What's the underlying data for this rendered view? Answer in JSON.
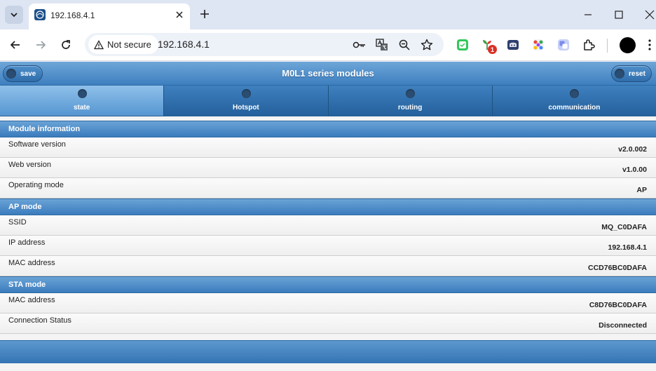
{
  "browser": {
    "tab_title": "192.168.4.1",
    "security_label": "Not secure",
    "url": "192.168.4.1",
    "extension_badge": "1"
  },
  "app": {
    "title": "M0L1 series modules",
    "save_label": "save",
    "reset_label": "reset",
    "nav": [
      "state",
      "Hotspot",
      "routing",
      "communication"
    ],
    "active_tab": "state"
  },
  "sections": [
    {
      "title": "Module information",
      "rows": [
        {
          "label": "Software version",
          "value": "v2.0.002"
        },
        {
          "label": "Web version",
          "value": "v1.0.00"
        },
        {
          "label": "Operating mode",
          "value": "AP"
        }
      ]
    },
    {
      "title": "AP mode",
      "rows": [
        {
          "label": "SSID",
          "value": "MQ_C0DAFA"
        },
        {
          "label": "IP address",
          "value": "192.168.4.1"
        },
        {
          "label": "MAC address",
          "value": "CCD76BC0DAFA"
        }
      ]
    },
    {
      "title": "STA mode",
      "rows": [
        {
          "label": "MAC address",
          "value": "C8D76BC0DAFA"
        },
        {
          "label": "Connection Status",
          "value": "Disconnected"
        }
      ]
    }
  ],
  "colors": {
    "header_blue": "#3d7fbf",
    "active_tab": "#8fc0ea",
    "badge_red": "#d93025"
  }
}
